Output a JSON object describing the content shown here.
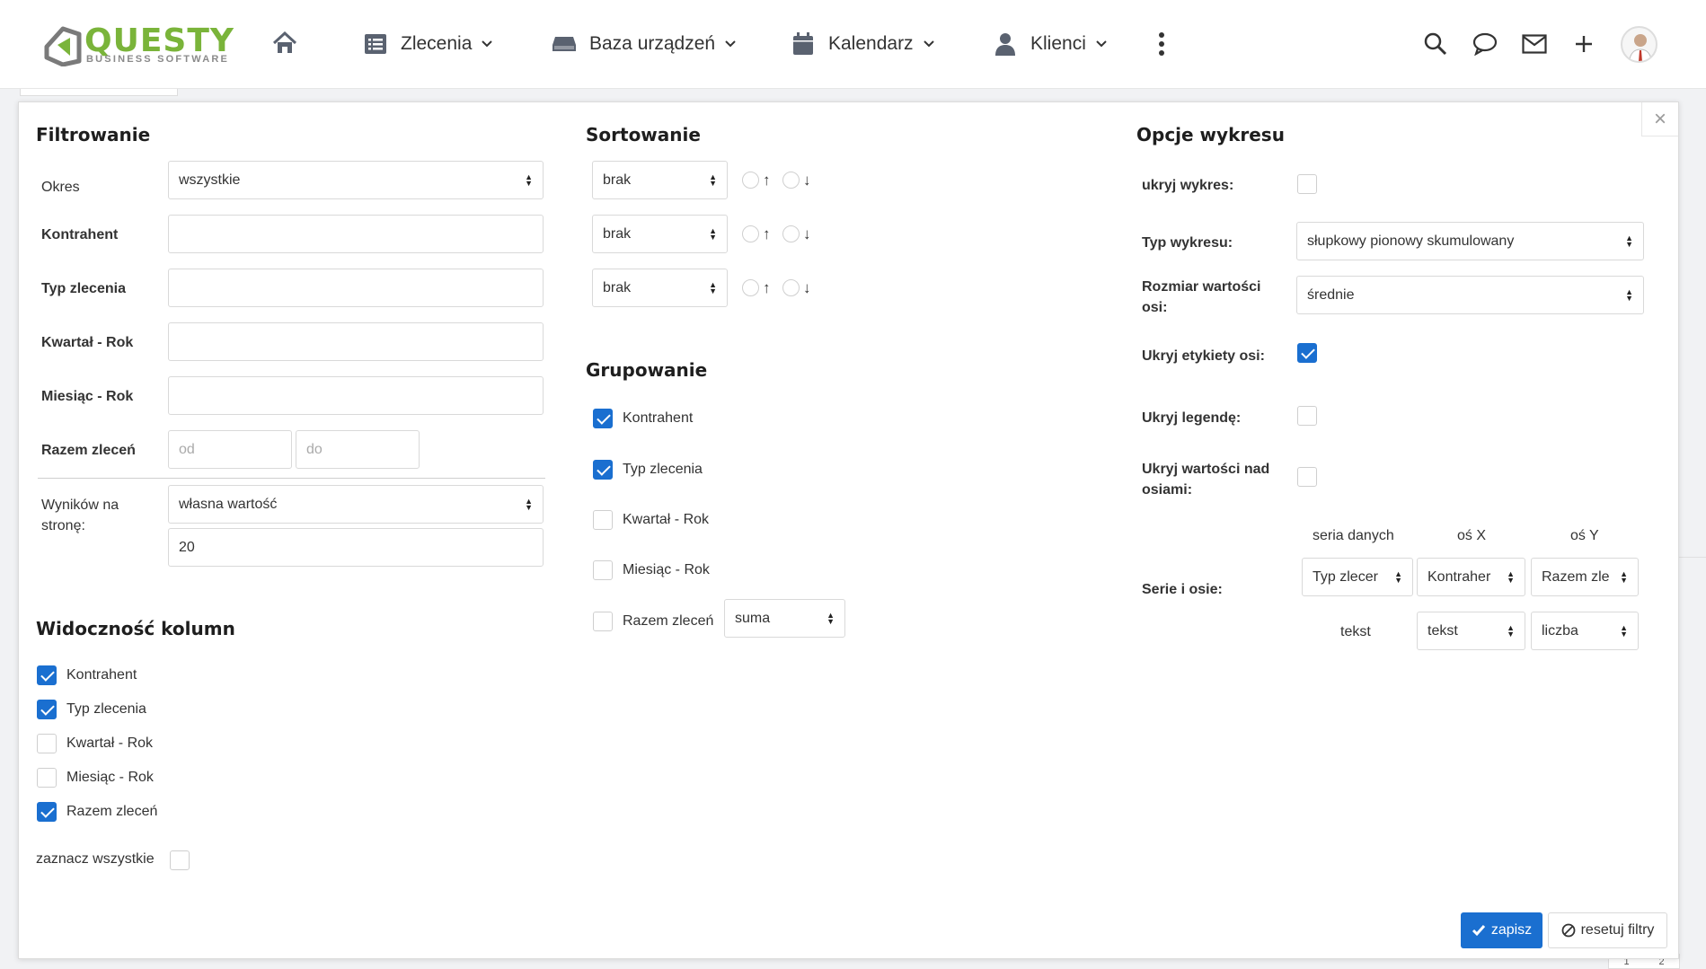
{
  "brand": {
    "name": "QUESTY",
    "tagline": "BUSINESS SOFTWARE",
    "accent": "#7ab43a"
  },
  "nav": {
    "home_icon": "home-icon",
    "items": [
      {
        "label": "Zlecenia",
        "icon": "list-icon"
      },
      {
        "label": "Baza urządzeń",
        "icon": "hdd-icon"
      },
      {
        "label": "Kalendarz",
        "icon": "calendar-icon"
      },
      {
        "label": "Klienci",
        "icon": "user-icon"
      }
    ],
    "more_icon": "kebab-icon",
    "right_icons": [
      "search-icon",
      "chat-icon",
      "mail-icon",
      "plus-icon"
    ]
  },
  "filter": {
    "title": "Filtrowanie",
    "okres": {
      "label": "Okres",
      "value": "wszystkie"
    },
    "kontrahent": {
      "label": "Kontrahent",
      "value": ""
    },
    "typ": {
      "label": "Typ zlecenia",
      "value": ""
    },
    "kwartal": {
      "label": "Kwartał - Rok",
      "value": ""
    },
    "miesiac": {
      "label": "Miesiąc - Rok",
      "value": ""
    },
    "razem": {
      "label": "Razem zleceń",
      "from_placeholder": "od",
      "to_placeholder": "do"
    },
    "wynikow": {
      "label_line1": "Wyników na",
      "label_line2": "stronę:",
      "select": "własna wartość",
      "value": "20"
    }
  },
  "columns": {
    "title": "Widoczność kolumn",
    "items": [
      {
        "label": "Kontrahent",
        "checked": true
      },
      {
        "label": "Typ zlecenia",
        "checked": true
      },
      {
        "label": "Kwartał - Rok",
        "checked": false
      },
      {
        "label": "Miesiąc - Rok",
        "checked": false
      },
      {
        "label": "Razem zleceń",
        "checked": true
      }
    ],
    "select_all": "zaznacz wszystkie"
  },
  "sort": {
    "title": "Sortowanie",
    "rows": [
      {
        "value": "brak"
      },
      {
        "value": "brak"
      },
      {
        "value": "brak"
      }
    ],
    "asc": "↑",
    "desc": "↓"
  },
  "group": {
    "title": "Grupowanie",
    "items": [
      {
        "label": "Kontrahent",
        "checked": true
      },
      {
        "label": "Typ zlecenia",
        "checked": true
      },
      {
        "label": "Kwartał - Rok",
        "checked": false
      },
      {
        "label": "Miesiąc - Rok",
        "checked": false
      },
      {
        "label": "Razem zleceń",
        "checked": false
      }
    ],
    "agg": "suma"
  },
  "chart_opts": {
    "title": "Opcje wykresu",
    "hide_chart": {
      "label": "ukryj wykres:",
      "checked": false
    },
    "chart_type": {
      "label": "Typ wykresu:",
      "value": "słupkowy pionowy skumulowany"
    },
    "axis_size": {
      "label_line1": "Rozmiar wartości",
      "label_line2": "osi:",
      "value": "średnie"
    },
    "hide_axis_labels": {
      "label": "Ukryj etykiety osi:",
      "checked": true
    },
    "hide_legend": {
      "label": "Ukryj legendę:",
      "checked": false
    },
    "hide_values": {
      "label_line1": "Ukryj wartości nad",
      "label_line2": "osiami:",
      "checked": false
    },
    "series": {
      "label": "Serie i osie:",
      "col_series": "seria danych",
      "col_x": "oś X",
      "col_y": "oś Y",
      "row1": [
        "Typ zlecer",
        "Kontraher",
        "Razem zle"
      ],
      "row2_text": "tekst",
      "row2": [
        "tekst",
        "liczba"
      ]
    }
  },
  "buttons": {
    "save": "zapisz",
    "reset": "resetuj filtry",
    "close": "×"
  },
  "pager": [
    "1",
    "2"
  ]
}
